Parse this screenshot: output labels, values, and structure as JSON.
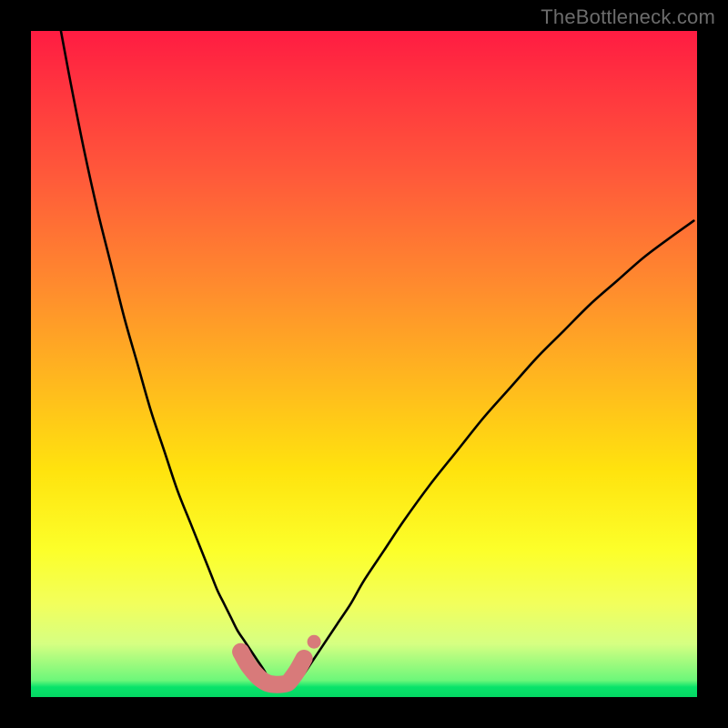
{
  "watermark": "TheBottleneck.com",
  "colors": {
    "frame": "#000000",
    "curve": "#000000",
    "marker_fill": "#d87a7a",
    "marker_stroke": "#c96b6b",
    "gradient_top": "#ff1c42",
    "gradient_bottom": "#04d864"
  },
  "chart_data": {
    "type": "line",
    "title": "",
    "xlabel": "",
    "ylabel": "",
    "x_range": [
      0,
      100
    ],
    "y_range": [
      0,
      100
    ],
    "note": "x and y are in percent of the inner plot area (left→right, top→bottom). Two curve branches form a V meeting near x≈36, y≈98. A short thick pink marker segment sits at the trough.",
    "series": [
      {
        "name": "left-branch",
        "x": [
          4.5,
          6,
          8,
          10,
          12,
          14,
          16,
          18,
          20,
          22,
          24,
          26,
          27,
          28,
          29,
          30,
          31,
          32,
          33,
          34,
          35,
          35.8
        ],
        "y": [
          0,
          8,
          18,
          27,
          35,
          43,
          50,
          57,
          63,
          69,
          74,
          79,
          81.5,
          84,
          86,
          88,
          90,
          91.5,
          93,
          94.5,
          96,
          97.5
        ]
      },
      {
        "name": "right-branch",
        "x": [
          40.2,
          41,
          42,
          44,
          46,
          48,
          50,
          53,
          56,
          60,
          64,
          68,
          72,
          76,
          80,
          84,
          88,
          92,
          96,
          99.5
        ],
        "y": [
          97.5,
          96.5,
          95,
          92,
          89,
          86,
          82.5,
          78,
          73.5,
          68,
          63,
          58,
          53.5,
          49,
          45,
          41,
          37.5,
          34,
          31,
          28.5
        ]
      }
    ],
    "markers": {
      "name": "trough-marker",
      "points_x": [
        31.5,
        32.5,
        33.5,
        34.5,
        35.5,
        36.5,
        37.5,
        38.5,
        39.0,
        40.0,
        41.0
      ],
      "points_y": [
        93.2,
        95.0,
        96.3,
        97.3,
        97.9,
        98.1,
        98.1,
        97.9,
        97.4,
        96.0,
        94.2
      ],
      "lone_point": {
        "x": 42.5,
        "y": 91.7
      }
    }
  }
}
